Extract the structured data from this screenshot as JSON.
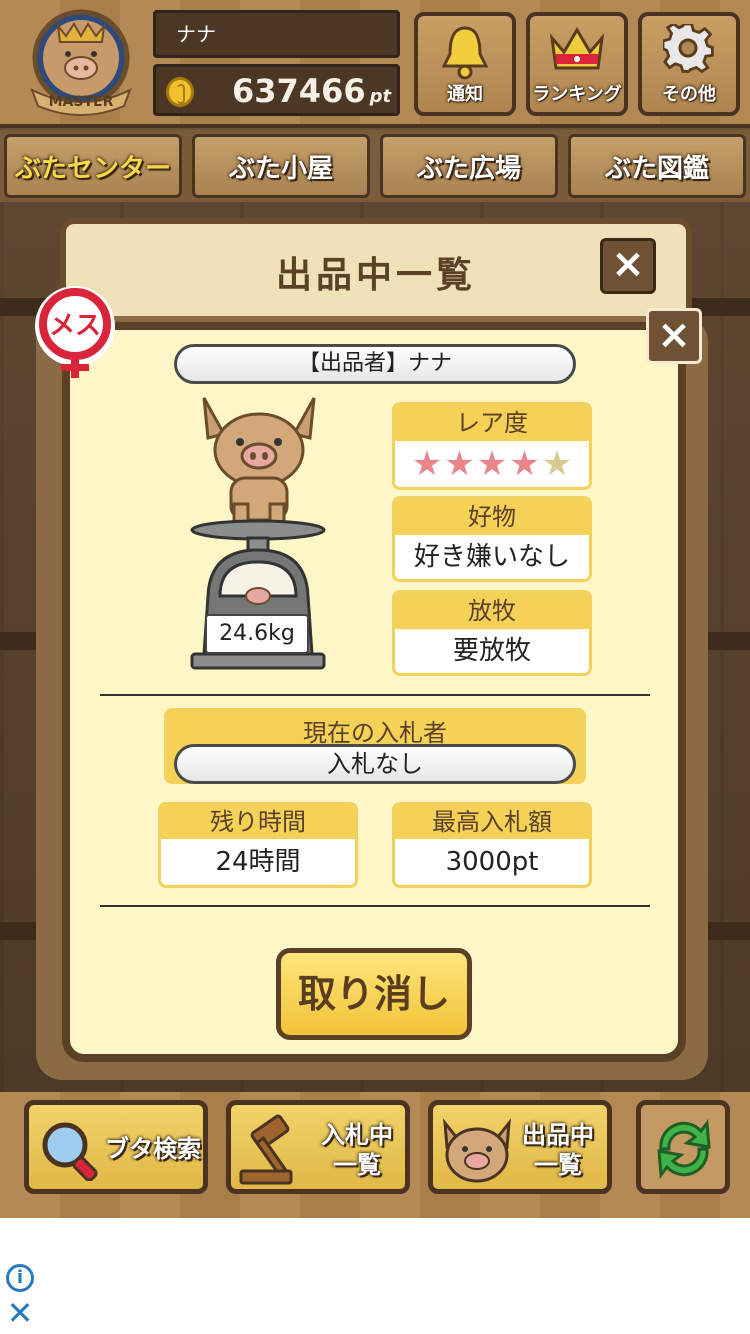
{
  "header": {
    "player_name": "ナナ",
    "points_value": "637466",
    "points_unit": "pt",
    "rank_badge": "MASTER",
    "buttons": [
      {
        "label": "通知",
        "icon": "bell-icon"
      },
      {
        "label": "ランキング",
        "icon": "crown-icon"
      },
      {
        "label": "その他",
        "icon": "gear-icon"
      }
    ]
  },
  "tabs": [
    "ぶたセンター",
    "ぶた小屋",
    "ぶた広場",
    "ぶた図鑑"
  ],
  "back_panel": {
    "title": "出品中一覧",
    "close": "×"
  },
  "modal": {
    "close": "×",
    "gender": "メス",
    "seller": "【出品者】ナナ",
    "weight": "24.6kg",
    "rarity": {
      "caption": "レア度",
      "stars_on": 4,
      "stars_total": 5,
      "star_glyph": "★"
    },
    "favorite": {
      "caption": "好物",
      "value": "好き嫌いなし"
    },
    "grazing": {
      "caption": "放牧",
      "value": "要放牧"
    },
    "current_bidder": {
      "caption": "現在の入札者",
      "value": "入札なし"
    },
    "remaining_time": {
      "caption": "残り時間",
      "value": "24時間"
    },
    "highest_bid": {
      "caption": "最高入札額",
      "value": "3000pt"
    },
    "cancel_label": "取り消し"
  },
  "toolbar": {
    "search_label": "ブタ検索",
    "bidding_line1": "入札中",
    "bidding_line2": "一覧",
    "listing_line1": "出品中",
    "listing_line2": "一覧"
  },
  "colors": {
    "accent_yellow": "#f5d257",
    "wood_dark": "#5b4025",
    "star_on": "#e8868a",
    "star_off": "#d7c894",
    "female_red": "#d9243a"
  }
}
